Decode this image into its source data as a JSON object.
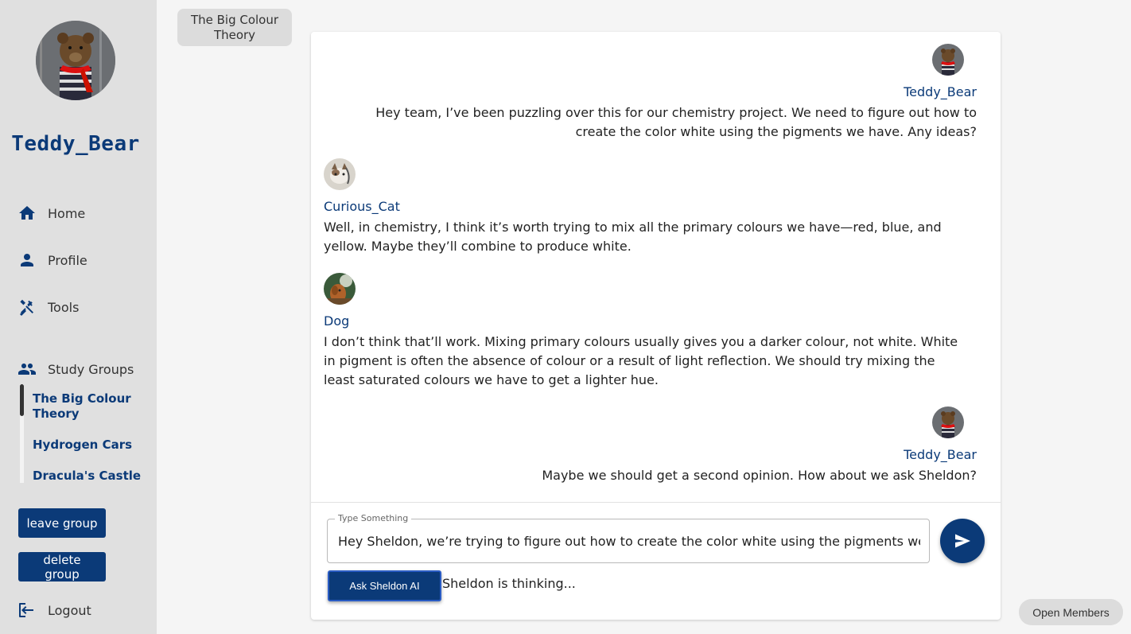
{
  "user": {
    "username": "Teddy_Bear"
  },
  "nav": {
    "home": "Home",
    "profile": "Profile",
    "tools": "Tools",
    "study_groups": "Study Groups",
    "logout": "Logout"
  },
  "groups": [
    {
      "name": "The Big Colour Theory",
      "active": true
    },
    {
      "name": "Hydrogen Cars",
      "active": false
    },
    {
      "name": "Dracula's Castle",
      "active": false
    }
  ],
  "buttons": {
    "leave": "leave group",
    "delete": "delete group",
    "ask": "Ask Sheldon AI",
    "members": "Open Members"
  },
  "current_group": "The Big Colour Theory",
  "messages": [
    {
      "author": "Teddy_Bear",
      "own": true,
      "text": "Hey team, I’ve been puzzling over this for our chemistry project. We need to figure out how to create the color white using the pigments we have. Any ideas?"
    },
    {
      "author": "Curious_Cat",
      "own": false,
      "text": "Well, in chemistry, I think it’s worth trying to mix all the primary colours we have—red, blue, and yellow. Maybe they’ll combine to produce white."
    },
    {
      "author": "Dog",
      "own": false,
      "text": "I don’t think that’ll work. Mixing primary colours usually gives you a darker colour, not white. White in pigment is often the absence of colour or a result of light reflection. We should try mixing the least saturated colours we have to get a lighter hue."
    },
    {
      "author": "Teddy_Bear",
      "own": true,
      "text": "Maybe we should get a second opinion. How about we ask Sheldon?"
    }
  ],
  "composer": {
    "label": "Type Something",
    "value": "Hey Sheldon, we’re trying to figure out how to create the color white using the pigments we have. What would you suggest?"
  },
  "status": "Sheldon is thinking...",
  "colors": {
    "brand": "#0b3a78",
    "sidebar": "#e0e0e0",
    "background": "#f5f5f5"
  },
  "icons": [
    "home-icon",
    "person-icon",
    "tools-icon",
    "group-icon",
    "logout-icon",
    "send-icon"
  ]
}
